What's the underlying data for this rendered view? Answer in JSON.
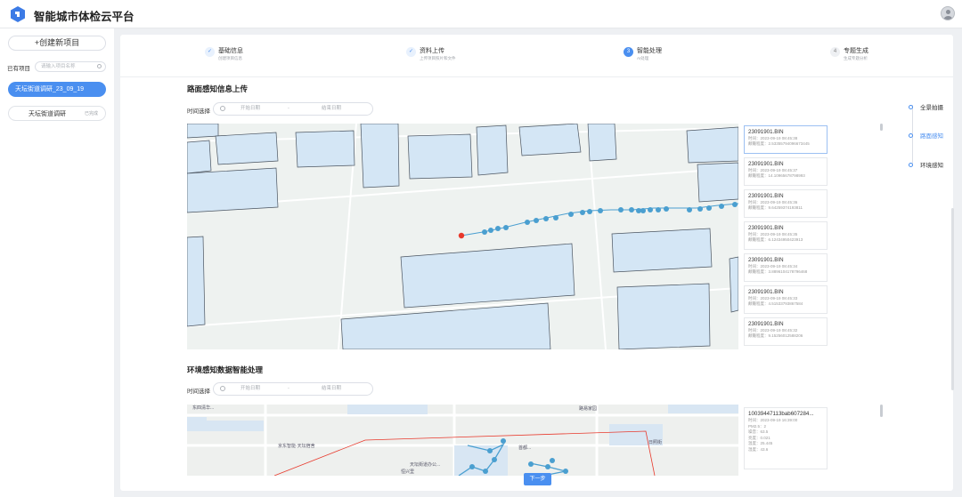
{
  "app": {
    "title": "智能城市体检云平台"
  },
  "sidebar": {
    "new_project": "+创建新项目",
    "exist_label": "已有项目",
    "search_placeholder": "请输入项目名称",
    "projects": [
      {
        "name": "天坛街道调研_23_09_19",
        "tag": ""
      },
      {
        "name": "天坛街道调研",
        "tag": "已完成"
      }
    ]
  },
  "steps": [
    {
      "title": "基础信息",
      "sub": "创建项目信息",
      "status": "done",
      "mark": "✓"
    },
    {
      "title": "资料上传",
      "sub": "上传项目照片和文件",
      "status": "done",
      "mark": "✓"
    },
    {
      "title": "智能处理",
      "sub": "AI处理",
      "status": "current",
      "mark": "3"
    },
    {
      "title": "专题生成",
      "sub": "生成专题分析",
      "status": "todo",
      "mark": "4"
    }
  ],
  "section1": {
    "title": "路面感知信息上传",
    "time_label": "时间选择",
    "start_placeholder": "开始日期",
    "sep": "-",
    "end_placeholder": "结束日期",
    "records": [
      {
        "name": "23091901.BIN",
        "time": "时间：2023-09-19 08:45:38",
        "score": "颠簸程度：2.53355794096673445"
      },
      {
        "name": "23091901.BIN",
        "time": "时间：2023-09-19 08:45:37",
        "score": "颠簸程度：14.10965678798993"
      },
      {
        "name": "23091901.BIN",
        "time": "时间：2023-09-19 08:45:36",
        "score": "颠簸程度：9.64259374193811"
      },
      {
        "name": "23091901.BIN",
        "time": "时间：2023-09-19 08:45:35",
        "score": "颠簸程度：6.12434950423913"
      },
      {
        "name": "23091901.BIN",
        "time": "时间：2023-09-19 08:45:34",
        "score": "颠簸程度：3.8896104178796468"
      },
      {
        "name": "23091901.BIN",
        "time": "时间：2023-09-19 08:45:33",
        "score": "颠簸程度：4.51533793867584"
      },
      {
        "name": "23091901.BIN",
        "time": "时间：2023-09-19 08:45:32",
        "score": "颠簸程度：9.15256012588206"
      }
    ]
  },
  "section2": {
    "title": "环境感知数据智能处理",
    "time_label": "时间选择",
    "start_placeholder": "开始日期",
    "sep": "-",
    "end_placeholder": "结束日期",
    "record": {
      "name": "10039447113bab607284...",
      "time": "时间：2023-09-19 16:39:00",
      "pm": "PM2.5：2",
      "noise": "噪音：63.5",
      "light": "亮度：0.021",
      "temp": "温度：25.445",
      "humid": "湿度：43.6"
    },
    "map_labels": [
      "东四清华...",
      "京东智能·天坛宿舍",
      "路易家园",
      "首都...",
      "日照街",
      "天坛街道办公...",
      "恒兴里"
    ]
  },
  "anchor": {
    "items": [
      "全景拍摄",
      "路面感知",
      "环境感知"
    ],
    "active": 1
  },
  "next_button": "下一步",
  "colors": {
    "accent": "#4a8ff0",
    "track": "#4a9fd0",
    "start_point": "#e8392c",
    "building": "#d4e6f5"
  }
}
